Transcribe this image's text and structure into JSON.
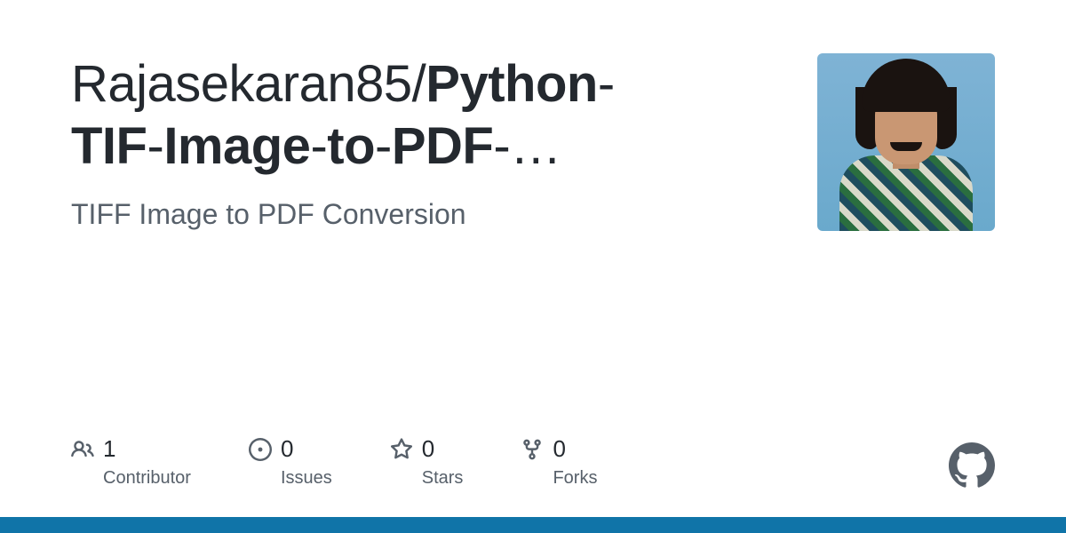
{
  "repo": {
    "owner": "Rajasekaran85",
    "name_part1": "Python",
    "name_part2": "TIF",
    "name_part3": "Image",
    "name_part4": "to",
    "name_part5": "PDF",
    "ellipsis": "…",
    "description": "TIFF Image to PDF Conversion"
  },
  "stats": {
    "contributors": {
      "value": "1",
      "label": "Contributor"
    },
    "issues": {
      "value": "0",
      "label": "Issues"
    },
    "stars": {
      "value": "0",
      "label": "Stars"
    },
    "forks": {
      "value": "0",
      "label": "Forks"
    }
  },
  "colors": {
    "accent": "#1074a8"
  }
}
